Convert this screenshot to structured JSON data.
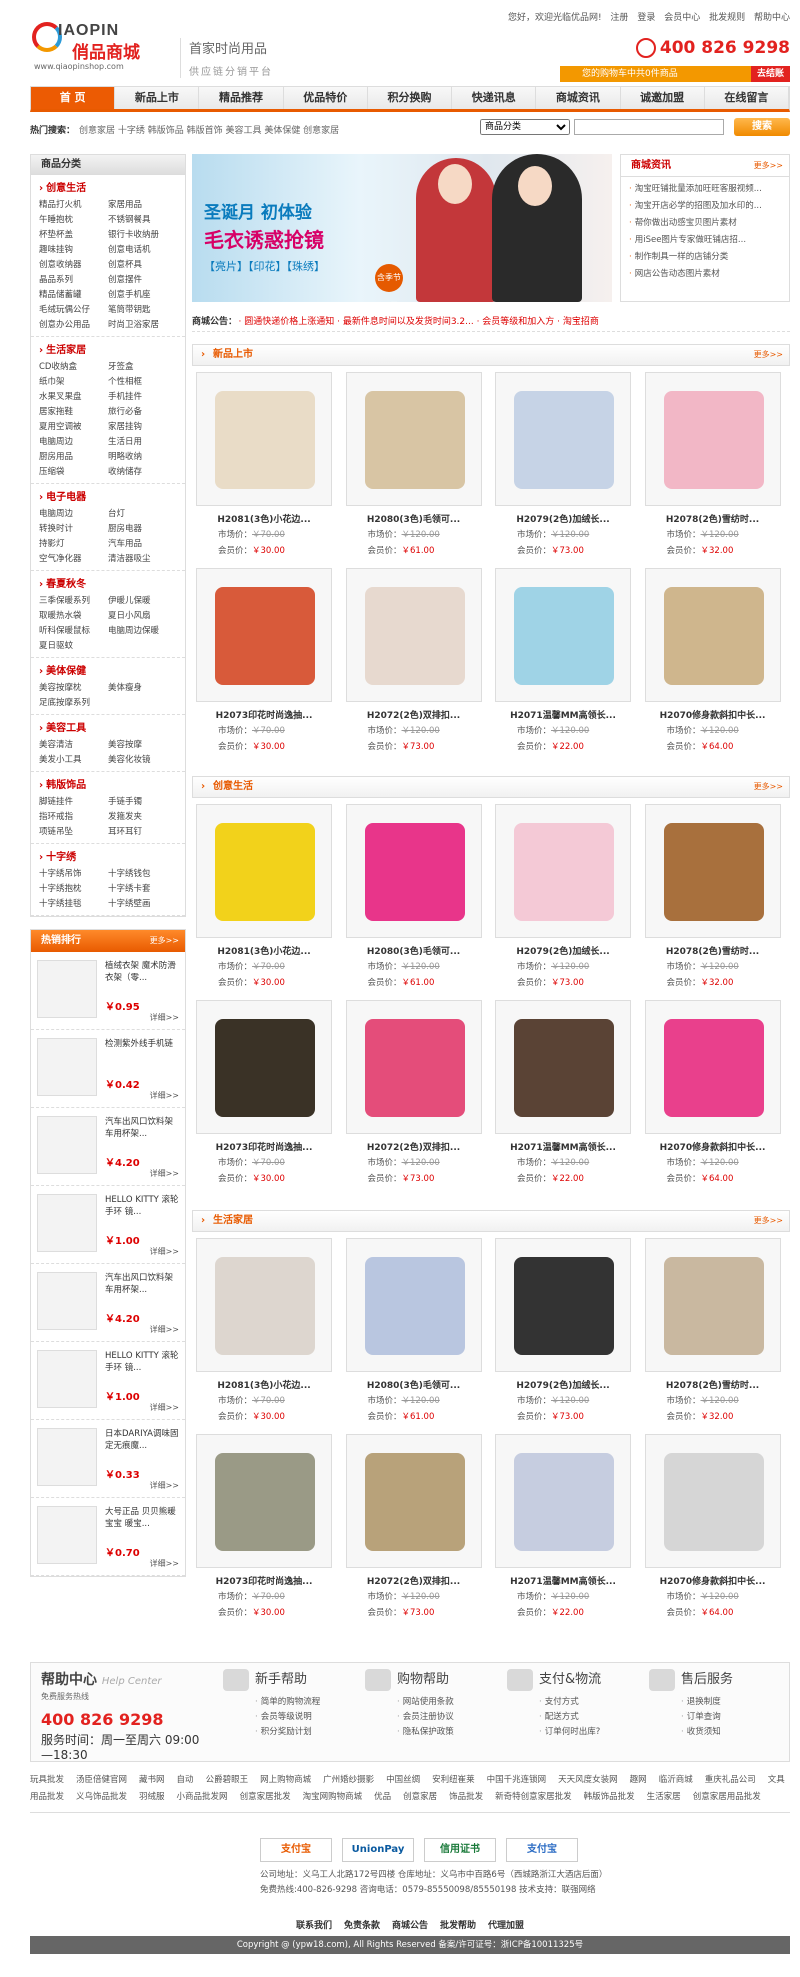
{
  "header": {
    "logo_en": "IAOPIN",
    "logo_cn": "俏品商城",
    "logo_url": "www.qiaopinshop.com",
    "slogan_1": "首家时尚用品",
    "slogan_2": "供应链分销平台",
    "top_links": [
      "您好，欢迎光临优品网!",
      "注册",
      "登录",
      "会员中心",
      "批发规则",
      "帮助中心"
    ],
    "phone": "400 826 9298",
    "cart_text": "您的购物车中共0件商品",
    "cart_go": "去结账"
  },
  "nav": [
    "首 页",
    "新品上市",
    "精品推荐",
    "优品特价",
    "积分换购",
    "快递讯息",
    "商城资讯",
    "诚邀加盟",
    "在线留言"
  ],
  "search": {
    "label": "热门搜索：",
    "keywords": "创意家居  十字绣  韩版饰品  韩版首饰  美容工具  美体保健  创意家居",
    "select": "商品分类",
    "button": "搜索"
  },
  "sidebar": {
    "title": "商品分类",
    "cats": [
      {
        "name": "创意生活",
        "items": [
          "精品打火机",
          "家居用品",
          "午睡抱枕",
          "不锈钢餐具",
          "杯垫杯盖",
          "银行卡收纳册",
          "趣味挂钩",
          "创意电话机",
          "创意收纳器",
          "创意杯具",
          "晶品系列",
          "创意摆件",
          "精品储蓄罐",
          "创意手机座",
          "毛绒玩偶公仔",
          "笔筒带钥匙",
          "创意办公用品",
          "时尚卫浴家居"
        ]
      },
      {
        "name": "生活家居",
        "items": [
          "CD收纳盒",
          "牙签盒",
          "纸巾架",
          "个性相框",
          "水果叉果盘",
          "手机挂件",
          "居家拖鞋",
          "旅行必备",
          "夏用空调被",
          "家居挂钩",
          "电脑周边",
          "生活日用",
          "厨房用品",
          "明略收纳",
          "压缩袋",
          "收纳储存"
        ]
      },
      {
        "name": "电子电器",
        "items": [
          "电脑周边",
          "台灯",
          "转换时计",
          "厨房电器",
          "持影灯",
          "汽车用品",
          "空气净化器",
          "清洁器吸尘"
        ]
      },
      {
        "name": "春夏秋冬",
        "items": [
          "三季保暖系列",
          "伊暖儿保暖",
          "取暖热水袋",
          "夏日小风扇",
          "听科保暖鼠标",
          "电脑周边保暖",
          "夏日驱蚊"
        ]
      },
      {
        "name": "美体保健",
        "items": [
          "美容按摩枕",
          "美体瘦身",
          "足底按摩系列"
        ]
      },
      {
        "name": "美容工具",
        "items": [
          "美容清洁",
          "美容按摩",
          "美发小工具",
          "美容化妆镜"
        ]
      },
      {
        "name": "韩版饰品",
        "items": [
          "脚链挂件",
          "手链手镯",
          "指环戒指",
          "发箍发夹",
          "项链吊坠",
          "耳环耳钉"
        ]
      },
      {
        "name": "十字绣",
        "items": [
          "十字绣吊饰",
          "十字绣钱包",
          "十字绣抱枕",
          "十字绣卡套",
          "十字绣挂毯",
          "十字绣壁画"
        ]
      }
    ],
    "hot_title": "热销排行",
    "hot_more": "更多>>",
    "hot_detail": "详细>>",
    "hot": [
      {
        "name": "植绒衣架 魔术防滑衣架（零...",
        "price": "￥0.95"
      },
      {
        "name": "检测紫外线手机链",
        "price": "￥0.42"
      },
      {
        "name": "汽车出风口饮料架 车用杯架...",
        "price": "￥4.20"
      },
      {
        "name": "HELLO KITTY 滚轮手环 镜...",
        "price": "￥1.00"
      },
      {
        "name": "汽车出风口饮料架 车用杯架...",
        "price": "￥4.20"
      },
      {
        "name": "HELLO KITTY 滚轮手环 镜...",
        "price": "￥1.00"
      },
      {
        "name": "日本DARIYA调味固定无痕魔...",
        "price": "￥0.33"
      },
      {
        "name": "大号正品 贝贝熊暖宝宝 暖宝...",
        "price": "￥0.70"
      }
    ]
  },
  "banner": {
    "line1": "圣诞月 初体验",
    "line2": "毛衣诱惑抢镜",
    "line3": "【亮片】【印花】【珠绣】",
    "badge": "含季节18元"
  },
  "news": {
    "title": "商城资讯",
    "more": "更多>>",
    "items": [
      "淘宝旺铺批量添加旺旺客服视频...",
      "淘宝开店必学的招图及加水印的...",
      "帮你做出动感宝贝图片素材",
      "用iSee图片专家做旺铺店招...",
      "制作制具一样的店铺分类",
      "网店公告动态图片素材"
    ]
  },
  "notice": {
    "label": "商城公告：",
    "text": "· 圆通快递价格上涨通知  · 最新件息时间以及发货时间3.2...  · 会员等级和加入方  · 淘宝招商"
  },
  "sections": [
    {
      "title": "新品上市",
      "more": "更多>>"
    },
    {
      "title": "创意生活",
      "more": "更多>>"
    },
    {
      "title": "生活家居",
      "more": "更多>>"
    }
  ],
  "product_labels": {
    "market": "市场价：",
    "member": "会员价："
  },
  "products": [
    [
      {
        "name": "H2081(3色)小花边...",
        "market": "￥70.00",
        "member": "￥30.00",
        "color": "#e9dcc7"
      },
      {
        "name": "H2080(3色)毛领可...",
        "market": "￥120.00",
        "member": "￥61.00",
        "color": "#d8c5a4"
      },
      {
        "name": "H2079(2色)加绒长...",
        "market": "￥120.00",
        "member": "￥73.00",
        "color": "#c6d3e6"
      },
      {
        "name": "H2078(2色)雪纺时...",
        "market": "￥120.00",
        "member": "￥32.00",
        "color": "#f2b7c6"
      },
      {
        "name": "H2073印花时尚逸抽...",
        "market": "￥70.00",
        "member": "￥30.00",
        "color": "#d85a3a"
      },
      {
        "name": "H2072(2色)双排扣...",
        "market": "￥120.00",
        "member": "￥73.00",
        "color": "#e7d9cf"
      },
      {
        "name": "H2071温馨MM高领长...",
        "market": "￥120.00",
        "member": "￥22.00",
        "color": "#9fd3e6"
      },
      {
        "name": "H2070修身款斜扣中长...",
        "market": "￥120.00",
        "member": "￥64.00",
        "color": "#cfb68d"
      }
    ],
    [
      {
        "name": "H2081(3色)小花边...",
        "market": "￥70.00",
        "member": "￥30.00",
        "color": "#f2d21b"
      },
      {
        "name": "H2080(3色)毛领可...",
        "market": "￥120.00",
        "member": "￥61.00",
        "color": "#e8358a"
      },
      {
        "name": "H2079(2色)加绒长...",
        "market": "￥120.00",
        "member": "￥73.00",
        "color": "#f4c9d6"
      },
      {
        "name": "H2078(2色)雪纺时...",
        "market": "￥120.00",
        "member": "￥32.00",
        "color": "#a8703d"
      },
      {
        "name": "H2073印花时尚逸抽...",
        "market": "￥70.00",
        "member": "￥30.00",
        "color": "#3a3226"
      },
      {
        "name": "H2072(2色)双排扣...",
        "market": "￥120.00",
        "member": "￥73.00",
        "color": "#e44d7a"
      },
      {
        "name": "H2071温馨MM高领长...",
        "market": "￥120.00",
        "member": "￥22.00",
        "color": "#5a4335"
      },
      {
        "name": "H2070修身款斜扣中长...",
        "market": "￥120.00",
        "member": "￥64.00",
        "color": "#e9408c"
      }
    ],
    [
      {
        "name": "H2081(3色)小花边...",
        "market": "￥70.00",
        "member": "￥30.00",
        "color": "#ddd6cf"
      },
      {
        "name": "H2080(3色)毛领可...",
        "market": "￥120.00",
        "member": "￥61.00",
        "color": "#b9c6e0"
      },
      {
        "name": "H2079(2色)加绒长...",
        "market": "￥120.00",
        "member": "￥73.00",
        "color": "#333333"
      },
      {
        "name": "H2078(2色)雪纺时...",
        "market": "￥120.00",
        "member": "￥32.00",
        "color": "#c9b8a0"
      },
      {
        "name": "H2073印花时尚逸抽...",
        "market": "￥70.00",
        "member": "￥30.00",
        "color": "#9a9a86"
      },
      {
        "name": "H2072(2色)双排扣...",
        "market": "￥120.00",
        "member": "￥73.00",
        "color": "#b8a27a"
      },
      {
        "name": "H2071温馨MM高领长...",
        "market": "￥120.00",
        "member": "￥22.00",
        "color": "#c6cde0"
      },
      {
        "name": "H2070修身款斜扣中长...",
        "market": "￥120.00",
        "member": "￥64.00",
        "color": "#d6d6d6"
      }
    ]
  ],
  "help": {
    "title": "帮助中心",
    "title_en": "Help Center",
    "hotline_lbl": "免费服务热线",
    "phone": "400 826 9298",
    "service_time": "服务时间：周一至周六 09:00—18:30",
    "cols": [
      {
        "title": "新手帮助",
        "items": [
          "简单的购物流程",
          "会员等级说明",
          "积分奖励计划"
        ]
      },
      {
        "title": "购物帮助",
        "items": [
          "网站使用条款",
          "会员注册协议",
          "隐私保护政策"
        ]
      },
      {
        "title": "支付&物流",
        "items": [
          "支付方式",
          "配送方式",
          "订单何时出库?"
        ]
      },
      {
        "title": "售后服务",
        "items": [
          "退换制度",
          "订单查询",
          "收货须知"
        ]
      }
    ]
  },
  "footer": {
    "links": [
      "玩具批发",
      "汤臣倍健官网",
      "藏书网",
      "自动",
      "公爵碧眼王",
      "网上购物商城",
      "广州婚纱摄影",
      "中国丝绸",
      "安利纽崔莱",
      "中国千兆连锁网",
      "天天风度女装网",
      "趣网",
      "临沂商城",
      "重庆礼品公司",
      "文具用品批发",
      "义乌饰品批发",
      "羽绒服",
      "小商品批发网",
      "创意家居批发",
      "淘宝网购物商城",
      "优品",
      "创意家居",
      "饰品批发",
      "新奇特创意家居批发",
      "韩版饰品批发",
      "生活家居",
      "创意家居用品批发"
    ],
    "pay": [
      "支付宝",
      "UnionPay",
      "信用证书",
      "支付宝"
    ],
    "addr1": "公司地址：义乌工人北路172号四楼    仓库地址：义乌市中百路6号（西城路浙江大酒店后面）",
    "addr2": "免费热线:400-826-9298 咨询电话：0579-85550098/85550198    技术支持：联强网络",
    "bot": [
      "联系我们",
      "免责条款",
      "商城公告",
      "批发帮助",
      "代理加盟"
    ],
    "copyright": "Copyright @         (ypw18.com), All Rights Reserved    备案/许可证号：浙ICP备10011325号"
  }
}
